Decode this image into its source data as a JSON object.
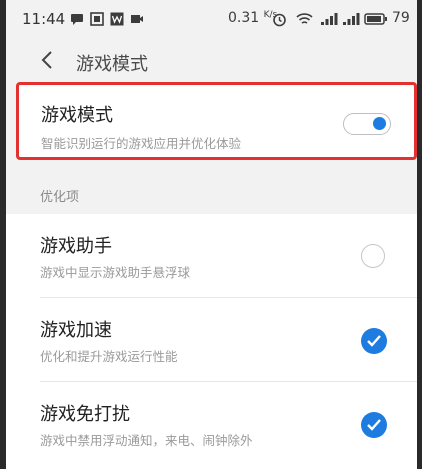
{
  "status_bar": {
    "time": "11:44",
    "net_speed": "0.31",
    "net_unit": "K/s",
    "battery": "79",
    "icons": [
      "chat-bubble-icon",
      "screenshot-icon",
      "app-w-icon",
      "video-icon",
      "alarm-icon",
      "wifi-icon",
      "signal-icon",
      "signal-icon",
      "battery-icon"
    ]
  },
  "header": {
    "back_icon": "chevron-left-icon",
    "title": "游戏模式"
  },
  "main_setting": {
    "label": "游戏模式",
    "description": "智能识别运行的游戏应用并优化体验",
    "enabled": true
  },
  "section": {
    "label": "优化项"
  },
  "options": [
    {
      "label": "游戏助手",
      "description": "游戏中显示游戏助手悬浮球",
      "checked": false
    },
    {
      "label": "游戏加速",
      "description": "优化和提升游戏运行性能",
      "checked": true
    },
    {
      "label": "游戏免打扰",
      "description": "游戏中禁用浮动通知，来电、闹钟除外",
      "checked": true
    }
  ],
  "colors": {
    "accent": "#1e7be0",
    "highlight_border": "#e53030",
    "background": "#f2f2f2"
  }
}
